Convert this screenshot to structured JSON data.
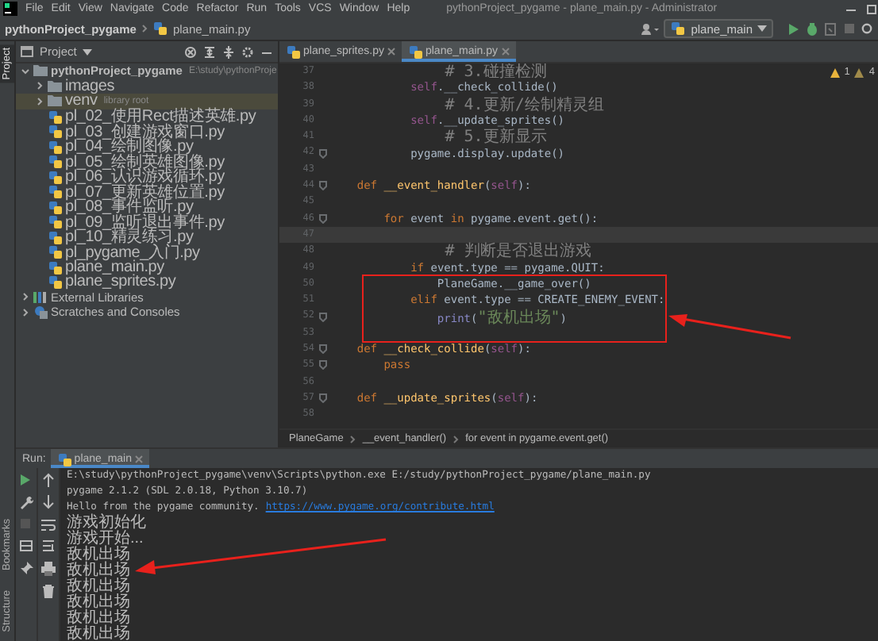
{
  "window": {
    "title": "pythonProject_pygame - plane_main.py - Administrator"
  },
  "menu": [
    "File",
    "Edit",
    "View",
    "Navigate",
    "Code",
    "Refactor",
    "Run",
    "Tools",
    "VCS",
    "Window",
    "Help"
  ],
  "navbar": {
    "breadcrumb": [
      "pythonProject_pygame",
      "plane_main.py"
    ],
    "run_config": "plane_main"
  },
  "side_stripe": {
    "top": [
      {
        "label": "Project",
        "selected": true
      }
    ],
    "bottom": [
      {
        "label": "Bookmarks",
        "selected": false
      },
      {
        "label": "Structure",
        "selected": false
      }
    ]
  },
  "project_panel": {
    "title": "Project",
    "tree": [
      {
        "label": "pythonProject_pygame",
        "note": "E:\\study\\pythonProje",
        "kind": "project",
        "expanded": true,
        "selected": false,
        "children": [
          {
            "label": "images",
            "kind": "folder",
            "expanded": false,
            "selected": false
          },
          {
            "label": "venv",
            "note": "library root",
            "kind": "folder",
            "expanded": false,
            "selected": true
          },
          {
            "label": "pl_02_使用Rect描述英雄.py",
            "kind": "python",
            "selected": false
          },
          {
            "label": "pl_03_创建游戏窗口.py",
            "kind": "python",
            "selected": false
          },
          {
            "label": "pl_04_绘制图像.py",
            "kind": "python",
            "selected": false
          },
          {
            "label": "pl_05_绘制英雄图像.py",
            "kind": "python",
            "selected": false
          },
          {
            "label": "pl_06_认识游戏循环.py",
            "kind": "python",
            "selected": false
          },
          {
            "label": "pl_07_更新英雄位置.py",
            "kind": "python",
            "selected": false
          },
          {
            "label": "pl_08_事件监听.py",
            "kind": "python",
            "selected": false
          },
          {
            "label": "pl_09_监听退出事件.py",
            "kind": "python",
            "selected": false
          },
          {
            "label": "pl_10_精灵练习.py",
            "kind": "python",
            "selected": false
          },
          {
            "label": "pl_pygame_入门.py",
            "kind": "python",
            "selected": false
          },
          {
            "label": "plane_main.py",
            "kind": "python",
            "selected": false
          },
          {
            "label": "plane_sprites.py",
            "kind": "python",
            "selected": false
          }
        ]
      },
      {
        "label": "External Libraries",
        "kind": "libraries",
        "expanded": false,
        "selected": false
      },
      {
        "label": "Scratches and Consoles",
        "kind": "scratches",
        "expanded": false,
        "selected": false
      }
    ]
  },
  "editor": {
    "tabs": [
      {
        "label": "plane_sprites.py",
        "selected": false
      },
      {
        "label": "plane_main.py",
        "selected": true
      }
    ],
    "inspections": [
      {
        "kind": "warning",
        "count": "1"
      },
      {
        "kind": "weak",
        "count": "4"
      }
    ],
    "lines": [
      {
        "number": "37",
        "current": false,
        "fold": false,
        "segments": [
          {
            "kind": "comment",
            "text": "            # 3.碰撞检测"
          }
        ]
      },
      {
        "number": "38",
        "current": false,
        "fold": false,
        "segments": [
          {
            "kind": "self",
            "text": "            self"
          },
          {
            "kind": "plain",
            "text": ".__check_collide()"
          }
        ]
      },
      {
        "number": "39",
        "current": false,
        "fold": false,
        "segments": [
          {
            "kind": "comment",
            "text": "            # 4.更新/绘制精灵组"
          }
        ]
      },
      {
        "number": "40",
        "current": false,
        "fold": false,
        "segments": [
          {
            "kind": "self",
            "text": "            self"
          },
          {
            "kind": "plain",
            "text": ".__update_sprites()"
          }
        ]
      },
      {
        "number": "41",
        "current": false,
        "fold": false,
        "segments": [
          {
            "kind": "comment",
            "text": "            # 5.更新显示"
          }
        ]
      },
      {
        "number": "42",
        "current": false,
        "fold": true,
        "segments": [
          {
            "kind": "plain",
            "text": "            pygame.display.update()"
          }
        ]
      },
      {
        "number": "43",
        "current": false,
        "fold": false
      },
      {
        "number": "44",
        "current": false,
        "fold": true,
        "segments": [
          {
            "kind": "keyword",
            "text": "    def "
          },
          {
            "kind": "function",
            "text": "__event_handler"
          },
          {
            "kind": "plain",
            "text": "("
          },
          {
            "kind": "self",
            "text": "self"
          },
          {
            "kind": "plain",
            "text": "):"
          }
        ]
      },
      {
        "number": "45",
        "current": false,
        "fold": false
      },
      {
        "number": "46",
        "current": false,
        "fold": true,
        "segments": [
          {
            "kind": "keyword",
            "text": "        for"
          },
          {
            "kind": "plain",
            "text": " event "
          },
          {
            "kind": "keyword",
            "text": "in"
          },
          {
            "kind": "plain",
            "text": " pygame.event.get():"
          }
        ]
      },
      {
        "number": "47",
        "current": true,
        "fold": false
      },
      {
        "number": "48",
        "current": false,
        "fold": false,
        "segments": [
          {
            "kind": "comment",
            "text": "            # 判断是否退出游戏"
          }
        ]
      },
      {
        "number": "49",
        "current": false,
        "fold": false,
        "segments": [
          {
            "kind": "keyword",
            "text": "            if"
          },
          {
            "kind": "plain",
            "text": " event.type == pygame.QUIT:"
          }
        ]
      },
      {
        "number": "50",
        "current": false,
        "fold": false,
        "segments": [
          {
            "kind": "plain",
            "text": "                PlaneGame.__game_over()"
          }
        ]
      },
      {
        "number": "51",
        "current": false,
        "fold": false,
        "segments": [
          {
            "kind": "keyword",
            "text": "            elif"
          },
          {
            "kind": "plain",
            "text": " event.type == CREATE_ENEMY_EVENT:"
          }
        ]
      },
      {
        "number": "52",
        "current": false,
        "fold": true,
        "segments": [
          {
            "kind": "builtin",
            "text": "                print"
          },
          {
            "kind": "plain",
            "text": "("
          },
          {
            "kind": "string",
            "text": "\"敌机出场\""
          },
          {
            "kind": "plain",
            "text": ")"
          }
        ]
      },
      {
        "number": "53",
        "current": false,
        "fold": false
      },
      {
        "number": "54",
        "current": false,
        "fold": true,
        "segments": [
          {
            "kind": "keyword",
            "text": "    def "
          },
          {
            "kind": "function",
            "text": "__check_collide"
          },
          {
            "kind": "plain",
            "text": "("
          },
          {
            "kind": "self",
            "text": "self"
          },
          {
            "kind": "plain",
            "text": "):"
          }
        ]
      },
      {
        "number": "55",
        "current": false,
        "fold": true,
        "segments": [
          {
            "kind": "keyword",
            "text": "        pass"
          }
        ]
      },
      {
        "number": "56",
        "current": false,
        "fold": false
      },
      {
        "number": "57",
        "current": false,
        "fold": true,
        "segments": [
          {
            "kind": "keyword",
            "text": "    def "
          },
          {
            "kind": "function",
            "text": "__update_sprites"
          },
          {
            "kind": "plain",
            "text": "("
          },
          {
            "kind": "self",
            "text": "self"
          },
          {
            "kind": "plain",
            "text": "):"
          }
        ]
      },
      {
        "number": "58",
        "current": false,
        "fold": false
      }
    ],
    "breadcrumb": [
      "PlaneGame",
      "__event_handler()",
      "for event in pygame.event.get()"
    ],
    "highlight_box": true,
    "callout_arrow": true
  },
  "run_panel": {
    "label": "Run:",
    "tabs": [
      {
        "label": "plane_main",
        "selected": true
      }
    ],
    "console": [
      {
        "kind": "command",
        "text": "E:\\study\\pythonProject_pygame\\venv\\Scripts\\python.exe E:/study/pythonProject_pygame/plane_main.py"
      },
      {
        "kind": "info",
        "text": "pygame 2.1.2 (SDL 2.0.18, Python 3.10.7)"
      },
      {
        "kind": "info",
        "text": "Hello from the pygame community.",
        "link": "https://www.pygame.org/contribute.html"
      },
      {
        "kind": "output",
        "text": "游戏初始化"
      },
      {
        "kind": "output",
        "text": "游戏开始..."
      },
      {
        "kind": "output",
        "text": "敌机出场"
      },
      {
        "kind": "output",
        "text": "敌机出场"
      },
      {
        "kind": "output",
        "text": "敌机出场"
      },
      {
        "kind": "output",
        "text": "敌机出场"
      },
      {
        "kind": "output",
        "text": "敌机出场"
      },
      {
        "kind": "output",
        "text": "敌机出场"
      }
    ],
    "callout_arrow": true
  }
}
